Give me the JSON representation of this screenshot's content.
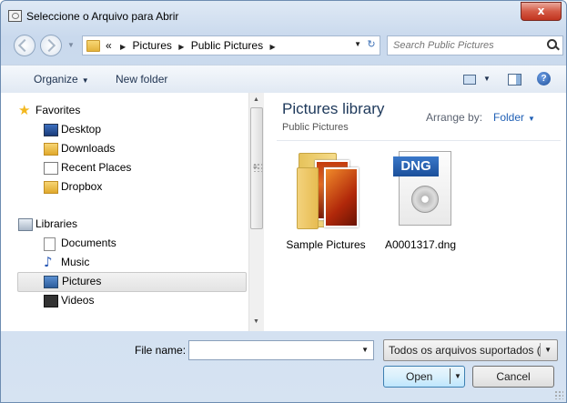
{
  "window": {
    "title": "Seleccione o Arquivo para Abrir",
    "close_glyph": "x"
  },
  "address": {
    "crumbs": [
      "«",
      "Pictures",
      "Public Pictures"
    ],
    "search_placeholder": "Search Public Pictures",
    "refresh_glyph": "↻"
  },
  "toolbar": {
    "organize_label": "Organize",
    "new_folder_label": "New folder",
    "help_glyph": "?"
  },
  "nav": {
    "favorites_label": "Favorites",
    "desktop_label": "Desktop",
    "downloads_label": "Downloads",
    "recent_label": "Recent Places",
    "dropbox_label": "Dropbox",
    "libraries_label": "Libraries",
    "documents_label": "Documents",
    "music_label": "Music",
    "pictures_label": "Pictures",
    "videos_label": "Videos"
  },
  "files": {
    "title": "Pictures library",
    "subtitle": "Public Pictures",
    "arrange_label": "Arrange by:",
    "arrange_value": "Folder",
    "items": [
      {
        "name": "Sample Pictures",
        "kind": "folder"
      },
      {
        "name": "A0001317.dng",
        "kind": "dng",
        "badge": "DNG"
      }
    ]
  },
  "bottom": {
    "file_name_label": "File name:",
    "file_name_value": "",
    "file_type_value": "Todos os arquivos suportados (",
    "open_label": "Open",
    "cancel_label": "Cancel"
  },
  "icons": [
    "folder-icon",
    "star-icon",
    "search-icon",
    "help-icon",
    "refresh-icon",
    "close-icon"
  ],
  "colors": {
    "accent": "#1f5fb5",
    "library_title": "#1e395b",
    "close_button": "#c1341f"
  }
}
